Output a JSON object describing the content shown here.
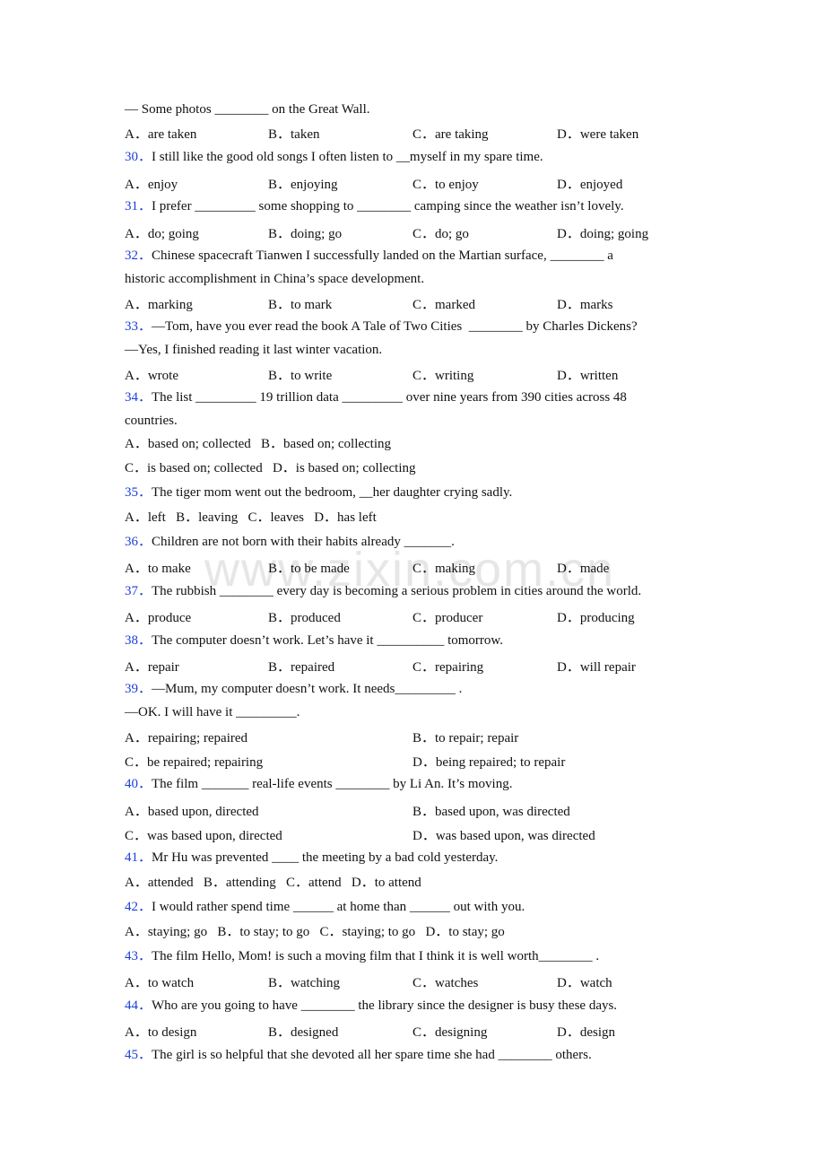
{
  "watermark": "www.zixin.com.cn",
  "intro": {
    "text": "— Some photos ________ on the Great Wall.",
    "options": [
      "A．are taken",
      "B．taken",
      "C．are taking",
      "D．were taken"
    ]
  },
  "questions": [
    {
      "num": "30．",
      "lines": [
        "I still like the good old songs I often listen to __myself in my spare time."
      ],
      "options": [
        "A．enjoy",
        "B．enjoying",
        "C．to enjoy",
        "D．enjoyed"
      ]
    },
    {
      "num": "31．",
      "lines": [
        "I prefer _________ some shopping to ________ camping since the weather isn’t lovely."
      ],
      "options": [
        "A．do; going",
        "B．doing; go",
        "C．do; go",
        "D．doing; going"
      ]
    },
    {
      "num": "32．",
      "lines": [
        "Chinese spacecraft Tianwen I successfully landed on the Martian surface, ________ a",
        "historic accomplishment in China’s space development."
      ],
      "options": [
        "A．marking",
        "B．to mark",
        "C．marked",
        "D．marks"
      ]
    },
    {
      "num": "33．",
      "lines": [
        "—Tom, have you ever read the book A Tale of Two Cities  ________ by Charles Dickens?",
        "—Yes, I finished reading it last winter vacation."
      ],
      "options": [
        "A．wrote",
        "B．to write",
        "C．writing",
        "D．written"
      ]
    },
    {
      "num": "34．",
      "lines": [
        "The list _________ 19 trillion data _________ over nine years from 390 cities across 48",
        "countries."
      ],
      "options": [
        "A．based on; collected",
        "B．based on; collecting",
        "C．is based on; collected",
        "D．is based on; collecting"
      ]
    },
    {
      "num": "35．",
      "lines": [
        "The tiger mom went out the bedroom, __her daughter crying sadly."
      ],
      "options": [
        "A．left",
        "B．leaving",
        "C．leaves",
        "D．has left"
      ]
    },
    {
      "num": "36．",
      "lines": [
        "Children are not born with their habits already _______."
      ],
      "options": [
        "A．to make",
        "B．to be made",
        "C．making",
        "D．made"
      ]
    },
    {
      "num": "37．",
      "lines": [
        "The rubbish ________ every day is becoming a serious problem in cities around the world."
      ],
      "options": [
        "A．produce",
        "B．produced",
        "C．producer",
        "D．producing"
      ]
    },
    {
      "num": "38．",
      "lines": [
        "The computer doesn’t work. Let’s have it __________ tomorrow."
      ],
      "options": [
        "A．repair",
        "B．repaired",
        "C．repairing",
        "D．will repair"
      ]
    },
    {
      "num": "39．",
      "lines": [
        "—Mum, my computer doesn’t work. It needs_________ .",
        "—OK. I will have it _________."
      ],
      "options": [
        "A．repairing; repaired",
        "B．to repair; repair",
        "C．be repaired; repairing",
        "D．being repaired; to repair"
      ]
    },
    {
      "num": "40．",
      "lines": [
        "The film _______ real-life events ________ by Li An. It’s moving."
      ],
      "options": [
        "A．based upon, directed",
        "B．based upon, was directed",
        "C．was based upon, directed",
        "D．was based upon, was directed"
      ]
    },
    {
      "num": "41．",
      "lines": [
        "Mr Hu was prevented ____ the meeting by a bad cold yesterday."
      ],
      "options": [
        "A．attended",
        "B．attending",
        "C．attend",
        "D．to attend"
      ]
    },
    {
      "num": "42．",
      "lines": [
        "I would rather spend time ______ at home than ______ out with you."
      ],
      "options": [
        "A．staying; go",
        "B．to stay; to go",
        "C．staying; to go",
        "D．to stay; go"
      ]
    },
    {
      "num": "43．",
      "lines": [
        "The film Hello, Mom! is such a moving film that I think it is well worth________ ."
      ],
      "options": [
        "A．to watch",
        "B．watching",
        "C．watches",
        "D．watch"
      ]
    },
    {
      "num": "44．",
      "lines": [
        "Who are you going to have ________ the library since the designer is busy these days."
      ],
      "options": [
        "A．to design",
        "B．designed",
        "C．designing",
        "D．design"
      ]
    },
    {
      "num": "45．",
      "lines": [
        "The girl is so helpful that she devoted all her spare time she had ________ others."
      ],
      "options": []
    }
  ]
}
